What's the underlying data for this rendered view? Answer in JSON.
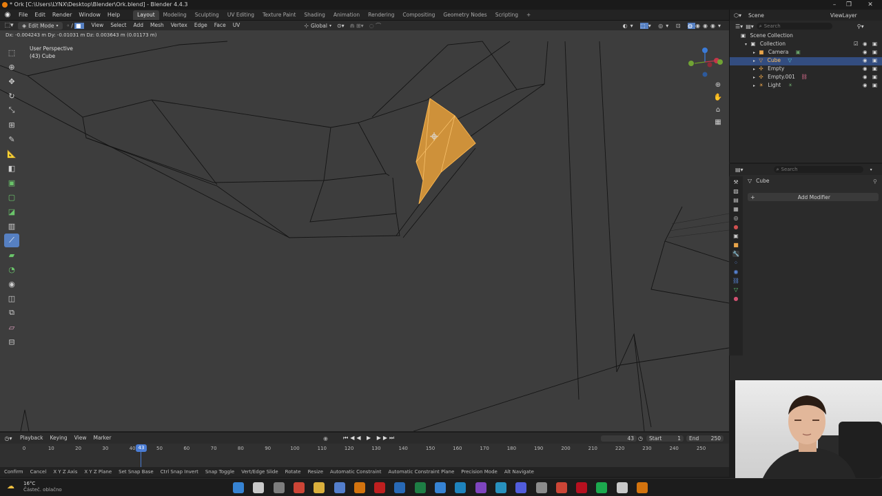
{
  "window": {
    "title": "* Ork [C:\\Users\\LYNX\\Desktop\\Blender\\Ork.blend] - Blender 4.4.3"
  },
  "menu": [
    "File",
    "Edit",
    "Render",
    "Window",
    "Help"
  ],
  "workspaces": [
    "Layout",
    "Modeling",
    "Sculpting",
    "UV Editing",
    "Texture Paint",
    "Shading",
    "Animation",
    "Rendering",
    "Compositing",
    "Geometry Nodes",
    "Scripting"
  ],
  "active_workspace": "Layout",
  "scene": {
    "label": "Scene",
    "view_layer": "ViewLayer"
  },
  "viewport_header": {
    "mode": "Edit Mode",
    "menus": [
      "View",
      "Select",
      "Add",
      "Mesh",
      "Vertex",
      "Edge",
      "Face",
      "UV"
    ],
    "orientation": "Global"
  },
  "viewport": {
    "operator_status": "Dx: -0.004243 m   Dy: -0.01031 m   Dz: 0.003643 m (0.01173 m)",
    "view_name": "User Perspective",
    "object_label": "(43) Cube",
    "colors": {
      "selection": "#f0a030",
      "background": "#3d3d3d",
      "wire": "#151515"
    }
  },
  "toolbar_icons": [
    "select-box-icon",
    "cursor-icon",
    "move-icon",
    "rotate-icon",
    "scale-icon",
    "transform-icon",
    "annotate-icon",
    "measure-icon",
    "add-cube-icon",
    "extrude-icon",
    "inset-icon",
    "bevel-icon",
    "loop-cut-icon",
    "knife-icon",
    "poly-build-icon",
    "spin-icon",
    "smooth-icon",
    "edge-slide-icon",
    "shrink-fatten-icon",
    "shear-icon",
    "rip-icon"
  ],
  "outliner": {
    "search_placeholder": "Search",
    "root": "Scene Collection",
    "collection": "Collection",
    "items": [
      {
        "name": "Camera",
        "selected": false,
        "color": "#e8a44a"
      },
      {
        "name": "Cube",
        "selected": true,
        "color": "#e8a44a"
      },
      {
        "name": "Empty",
        "selected": false,
        "color": "#e8a44a"
      },
      {
        "name": "Empty.001",
        "selected": false,
        "color": "#e8a44a"
      },
      {
        "name": "Light",
        "selected": false,
        "color": "#e8a44a"
      }
    ]
  },
  "properties": {
    "search_placeholder": "Search",
    "object_name": "Cube",
    "add_modifier": "Add Modifier"
  },
  "timeline": {
    "menus": [
      "Playback",
      "Keying",
      "View",
      "Marker"
    ],
    "current_frame": "43",
    "start_label": "Start",
    "start": "1",
    "end_label": "End",
    "end": "250",
    "ticks": [
      "0",
      "10",
      "20",
      "30",
      "40",
      "50",
      "60",
      "70",
      "80",
      "90",
      "100",
      "110",
      "120",
      "130",
      "140",
      "150",
      "160",
      "170",
      "180",
      "190",
      "200",
      "210",
      "220",
      "230",
      "240",
      "250"
    ],
    "marker": "43"
  },
  "statusbar": {
    "hints": [
      "Confirm",
      "Cancel",
      "X Y Z Axis",
      "X Y Z Plane",
      "Set Snap Base",
      "Ctrl Snap Invert",
      "Snap Toggle",
      "Vert/Edge Slide",
      "Rotate",
      "Resize",
      "Automatic Constraint",
      "Automatic Constraint Plane",
      "Precision Mode",
      "Alt Navigate"
    ]
  },
  "taskbar": {
    "weather_temp": "16°C",
    "weather_desc": "Částeč. oblačno",
    "apps": [
      "windows-start-icon",
      "search-icon",
      "task-view-icon",
      "chrome-icon",
      "file-explorer-icon",
      "store-icon",
      "vlc-icon",
      "acrobat-icon",
      "outlook-icon",
      "excel-icon",
      "photos-icon",
      "edge-icon",
      "visual-studio-icon",
      "edge-alt-icon",
      "discord-icon",
      "settings-icon",
      "chrome-alt-icon",
      "opera-icon",
      "spotify-icon",
      "tool-icon",
      "blender-icon"
    ]
  }
}
